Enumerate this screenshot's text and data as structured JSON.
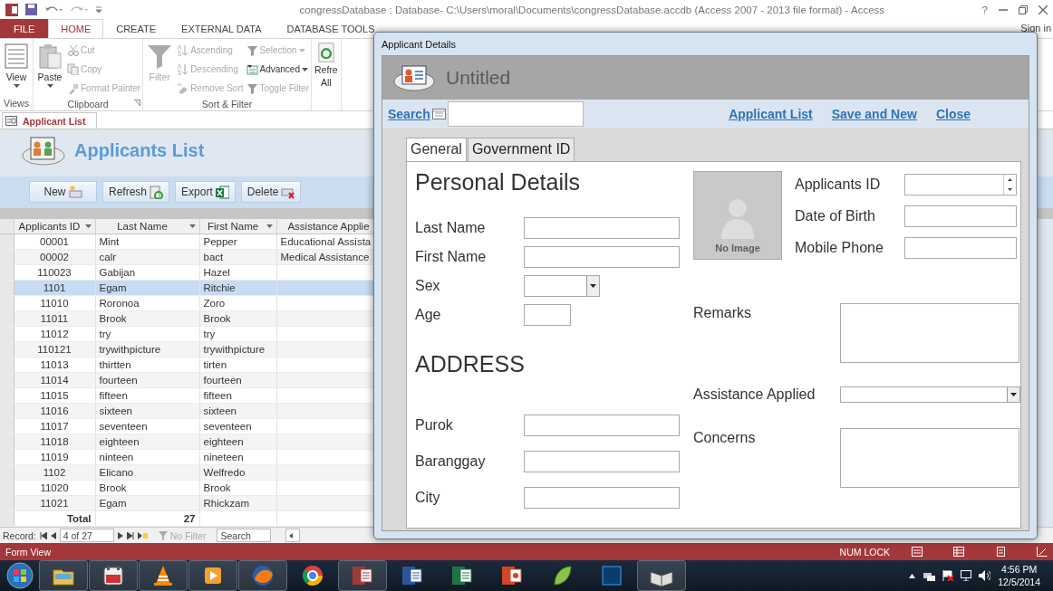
{
  "window": {
    "title": "congressDatabase : Database- C:\\Users\\moral\\Documents\\congressDatabase.accdb (Access 2007 - 2013 file format) - Access",
    "help": "?"
  },
  "ribbon": {
    "tabs": [
      {
        "label": "FILE",
        "kind": "file",
        "selected": false
      },
      {
        "label": "HOME",
        "kind": "tab",
        "selected": true
      },
      {
        "label": "CREATE",
        "kind": "tab",
        "selected": false
      },
      {
        "label": "EXTERNAL DATA",
        "kind": "tab",
        "selected": false
      },
      {
        "label": "DATABASE TOOLS",
        "kind": "tab",
        "selected": false
      }
    ],
    "sign_in": "Sign in",
    "groups": [
      {
        "label": "Views",
        "launcher": false,
        "columns": [
          [
            {
              "label": "View",
              "kind": "large",
              "disabled": false,
              "dropdown": true
            }
          ]
        ]
      },
      {
        "label": "Clipboard",
        "launcher": true,
        "columns": [
          [
            {
              "label": "Paste",
              "kind": "large",
              "disabled": false,
              "dropdown": true
            }
          ],
          [
            {
              "label": "Cut",
              "kind": "small",
              "disabled": true,
              "dropdown": false
            },
            {
              "label": "Copy",
              "kind": "small",
              "disabled": true,
              "dropdown": false
            },
            {
              "label": "Format Painter",
              "kind": "small",
              "disabled": true,
              "dropdown": false
            }
          ]
        ]
      },
      {
        "label": "Sort & Filter",
        "launcher": false,
        "columns": [
          [
            {
              "label": "Filter",
              "kind": "large",
              "disabled": true,
              "dropdown": false
            }
          ],
          [
            {
              "label": "Ascending",
              "kind": "small",
              "disabled": true,
              "dropdown": false
            },
            {
              "label": "Descending",
              "kind": "small",
              "disabled": true,
              "dropdown": false
            },
            {
              "label": "Remove Sort",
              "kind": "small",
              "disabled": true,
              "dropdown": false
            }
          ],
          [
            {
              "label": "Selection",
              "kind": "small",
              "disabled": true,
              "dropdown": true
            },
            {
              "label": "Advanced",
              "kind": "small",
              "disabled": false,
              "dropdown": true
            },
            {
              "label": "Toggle Filter",
              "kind": "small",
              "disabled": true,
              "dropdown": false
            }
          ]
        ]
      },
      {
        "launcher": false,
        "columns": [
          [
            {
              "label": "Refre",
              "label_2": "All",
              "kind": "large",
              "disabled": false,
              "dropdown": false
            }
          ]
        ]
      }
    ]
  },
  "document_tab": {
    "label": "Applicant List",
    "selected": true
  },
  "form": {
    "title": "Applicants List",
    "buttons": [
      "New",
      "Refresh",
      "Export",
      "Delete"
    ],
    "table": {
      "columns": [
        {
          "label": "Applicants ID",
          "menu": true
        },
        {
          "label": "Last Name",
          "menu": true
        },
        {
          "label": "First Name",
          "menu": true
        },
        {
          "label": "Assistance Applie",
          "menu": false
        }
      ],
      "rows": [
        {
          "cells": [
            "00001",
            "Mint",
            "Pepper",
            "Educational Assista"
          ],
          "selected": false
        },
        {
          "cells": [
            "00002",
            "calr",
            "bact",
            "Medical Assistance"
          ],
          "selected": false
        },
        {
          "cells": [
            "110023",
            "Gabijan",
            "Hazel",
            ""
          ],
          "selected": false
        },
        {
          "cells": [
            "1101",
            "Egam",
            "Ritchie",
            ""
          ],
          "selected": true
        },
        {
          "cells": [
            "11010",
            "Roronoa",
            "Zoro",
            ""
          ],
          "selected": false
        },
        {
          "cells": [
            "11011",
            "Brook",
            "Brook",
            ""
          ],
          "selected": false
        },
        {
          "cells": [
            "11012",
            "try",
            "try",
            ""
          ],
          "selected": false
        },
        {
          "cells": [
            "110121",
            "trywithpicture",
            "trywithpicture",
            ""
          ],
          "selected": false
        },
        {
          "cells": [
            "11013",
            "thirtten",
            "tirten",
            ""
          ],
          "selected": false
        },
        {
          "cells": [
            "11014",
            "fourteen",
            "fourteen",
            ""
          ],
          "selected": false
        },
        {
          "cells": [
            "11015",
            "fifteen",
            "fifteen",
            ""
          ],
          "selected": false
        },
        {
          "cells": [
            "11016",
            "sixteen",
            "sixteen",
            ""
          ],
          "selected": false
        },
        {
          "cells": [
            "11017",
            "seventeen",
            "seventeen",
            ""
          ],
          "selected": false
        },
        {
          "cells": [
            "11018",
            "eighteen",
            "eighteen",
            ""
          ],
          "selected": false
        },
        {
          "cells": [
            "11019",
            "ninteen",
            "nineteen",
            ""
          ],
          "selected": false
        },
        {
          "cells": [
            "1102",
            "Elicano",
            "Welfredo",
            ""
          ],
          "selected": false
        },
        {
          "cells": [
            "11020",
            "Brook",
            "Brook",
            ""
          ],
          "selected": false
        },
        {
          "cells": [
            "11021",
            "Egam",
            "Rhickzam",
            ""
          ],
          "selected": false
        }
      ],
      "total_label": "Total",
      "total_value": "27"
    }
  },
  "record_nav": {
    "label": "Record:",
    "position": "4 of 27",
    "filter": "No Filter",
    "filter_disabled": true,
    "search": "Search"
  },
  "status_bar": {
    "text": "Form View",
    "indicator": "NUM LOCK"
  },
  "dialog": {
    "title": "Applicant Details",
    "header": "Untitled",
    "search_label": "Search",
    "links": [
      "Applicant List",
      "Save and New",
      "Close"
    ],
    "tabs": [
      {
        "label": "General",
        "selected": true
      },
      {
        "label": "Government ID",
        "selected": false
      }
    ],
    "sections": [
      {
        "heading": "Personal Details",
        "fields": [
          {
            "label": "Last Name",
            "kind": "text"
          },
          {
            "label": "First Name",
            "kind": "text"
          },
          {
            "label": "Sex",
            "kind": "select"
          },
          {
            "label": "Age",
            "kind": "short"
          }
        ]
      },
      {
        "heading": "ADDRESS",
        "fields": [
          {
            "label": "Purok",
            "kind": "text"
          },
          {
            "label": "Baranggay",
            "kind": "text"
          },
          {
            "label": "City",
            "kind": "text"
          }
        ]
      }
    ],
    "photo_caption": "No Image",
    "id_fields": [
      {
        "label": "Applicants ID",
        "kind": "spin"
      },
      {
        "label": "Date of Birth",
        "kind": "text"
      },
      {
        "label": "Mobile Phone",
        "kind": "text"
      }
    ],
    "lower_fields": [
      {
        "label": "Remarks",
        "kind": "memo"
      },
      {
        "label": "Assistance Applied",
        "kind": "combo"
      },
      {
        "label": "Concerns",
        "kind": "memo"
      }
    ]
  },
  "taskbar": {
    "apps": [
      {
        "kind": "folder",
        "running": true
      },
      {
        "kind": "tile",
        "running": true
      },
      {
        "kind": "cone",
        "running": true
      },
      {
        "kind": "play",
        "running": true
      },
      {
        "kind": "globe",
        "running": true
      },
      {
        "kind": "ring",
        "running": false
      },
      {
        "kind": "access",
        "running": true
      },
      {
        "kind": "word",
        "running": false
      },
      {
        "kind": "excel",
        "running": false
      },
      {
        "kind": "slides",
        "running": false
      },
      {
        "kind": "leaf",
        "running": false
      },
      {
        "kind": "square",
        "running": false
      },
      {
        "kind": "book",
        "running": true
      }
    ],
    "time": "4:56 PM",
    "date": "12/5/2014"
  }
}
